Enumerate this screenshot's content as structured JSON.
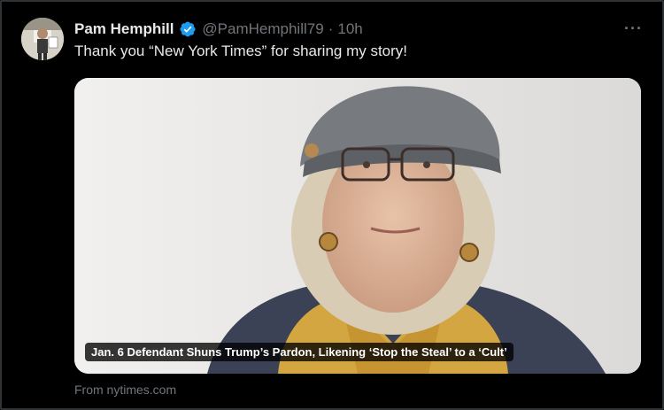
{
  "tweet": {
    "author_name": "Pam Hemphill",
    "handle": "@PamHemphill79",
    "separator": "·",
    "time": "10h",
    "text": "Thank you “New York Times” for sharing my story!",
    "more_label": "···"
  },
  "card": {
    "title": "Jan. 6 Defendant Shuns Trump’s Pardon, Likening ‘Stop the Steal’ to a ‘Cult’",
    "source": "From nytimes.com"
  },
  "icons": {
    "verified": "verified-badge-icon",
    "more": "more-options-icon"
  },
  "colors": {
    "background": "#000000",
    "text_primary": "#e7e9ea",
    "text_secondary": "#71767b",
    "verified": "#1d9bf0"
  }
}
